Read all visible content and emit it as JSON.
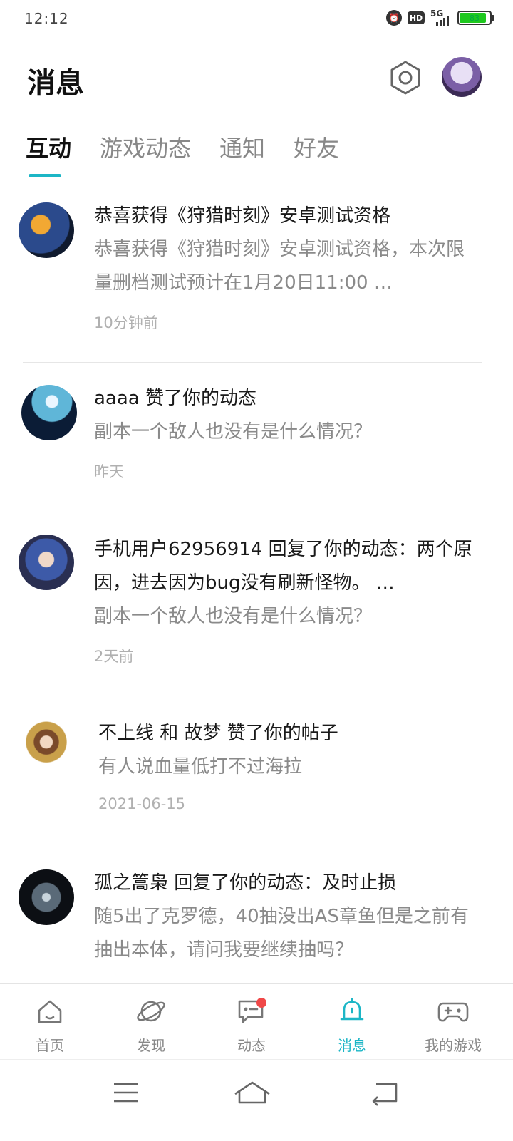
{
  "status_bar": {
    "time": "12:12",
    "network": "5G",
    "hd": "HD",
    "battery": "83"
  },
  "header": {
    "title": "消息"
  },
  "tabs": [
    {
      "label": "互动",
      "active": true
    },
    {
      "label": "游戏动态"
    },
    {
      "label": "通知"
    },
    {
      "label": "好友"
    }
  ],
  "items": [
    {
      "headline": "恭喜获得《狩猎时刻》安卓测试资格",
      "preview": "恭喜获得《狩猎时刻》安卓测试资格，本次限量删档测试预计在1月20日11:00 …",
      "time": "10分钟前",
      "avatar_colors": [
        "#2b4a8c",
        "#f2a833",
        "#101a2e"
      ]
    },
    {
      "headline": "aaaa 赞了你的动态",
      "preview": "副本一个敌人也没有是什么情况？",
      "time": "昨天",
      "avatar_colors": [
        "#0b1c36",
        "#5fb6d8",
        "#eaf6ff"
      ]
    },
    {
      "headline": "手机用户62956914 回复了你的动态：两个原因，进去因为bug没有刷新怪物。 …",
      "preview": "副本一个敌人也没有是什么情况？",
      "time": "2天前",
      "avatar_colors": [
        "#2a2f52",
        "#3d5aa8",
        "#f0d8c8"
      ]
    },
    {
      "headline": "不上线 和 故梦 赞了你的帖子",
      "preview": "有人说血量低打不过海拉",
      "time": "2021-06-15",
      "avatar_colors": [
        "#ffffff",
        "#c9a04a",
        "#7a4a2a"
      ]
    },
    {
      "headline": "孤之篙枭 回复了你的动态：及时止损",
      "preview": "随5出了克罗德，40抽没出AS章鱼但是之前有抽出本体，请问我要继续抽吗？",
      "time": "",
      "avatar_colors": [
        "#0c0f14",
        "#5a6a78",
        "#c8d4dc"
      ]
    }
  ],
  "bottom_nav": [
    {
      "label": "首页",
      "icon": "home-icon"
    },
    {
      "label": "发现",
      "icon": "planet-icon"
    },
    {
      "label": "动态",
      "icon": "chat-icon",
      "badge": true
    },
    {
      "label": "消息",
      "icon": "bell-icon",
      "active": true
    },
    {
      "label": "我的游戏",
      "icon": "gamepad-icon"
    }
  ],
  "colors": {
    "accent": "#1cb6c6",
    "badge": "#f04848"
  }
}
